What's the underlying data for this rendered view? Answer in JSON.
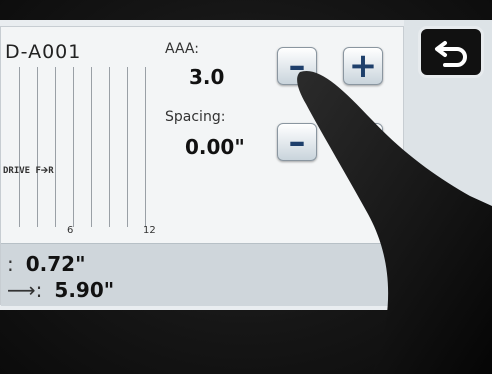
{
  "cartridge": {
    "id": "D-A001"
  },
  "preview": {
    "text": "DRIVE F🡪R"
  },
  "ruler": {
    "ticks": [
      "6",
      "12"
    ]
  },
  "size": {
    "label": "AAA:",
    "value": "3.0",
    "minus": "–",
    "plus": "+"
  },
  "spacing": {
    "label": "Spacing:",
    "value": "0.00\"",
    "minus": "–",
    "plus": "+"
  },
  "measurements": {
    "row1": {
      "mark": ":",
      "value": "0.72\""
    },
    "row2": {
      "mark": "⟶:",
      "value": "5.90\""
    }
  },
  "icons": {
    "back": "back-arrow-icon"
  },
  "colors": {
    "accent": "#1e3f6b",
    "blue_button": "#2a62bd",
    "back_button": "#111111"
  }
}
